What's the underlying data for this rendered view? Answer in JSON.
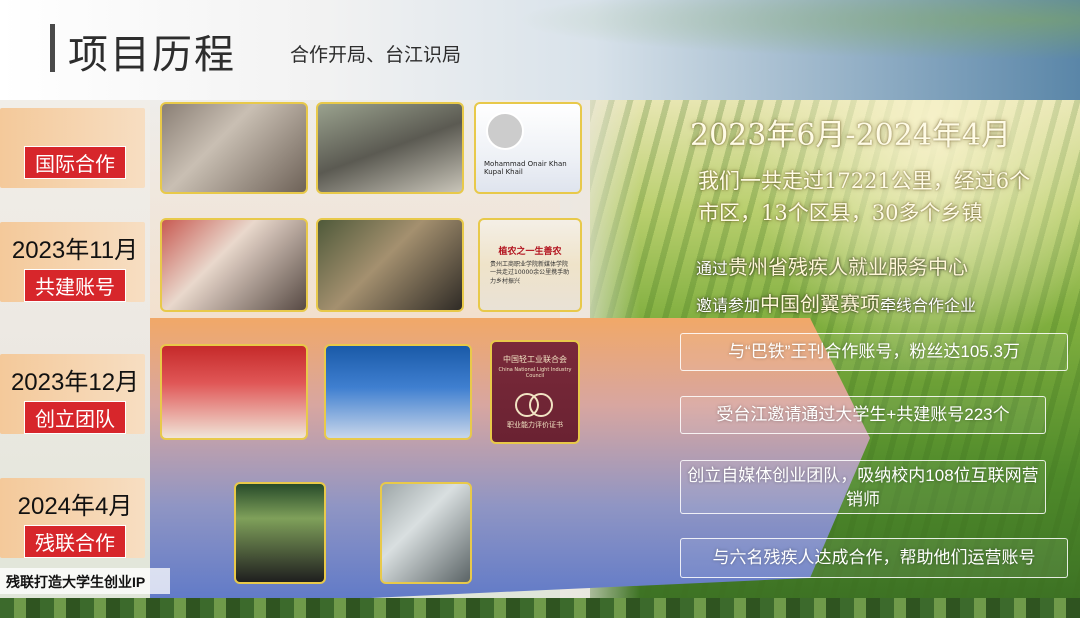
{
  "header": {
    "title": "项目历程",
    "subtitle": "合作开局、台江识局"
  },
  "milestones": [
    {
      "year": "",
      "tag": "国际合作"
    },
    {
      "year": "2023年11月",
      "tag": "共建账号"
    },
    {
      "year": "2023年12月",
      "tag": "创立团队"
    },
    {
      "year": "2024年4月",
      "tag": "残联合作"
    }
  ],
  "photos": {
    "web_profile_name": "Mohammad Onair Khan Kupal Khail",
    "doc_heading": "植农之一生善农",
    "doc_body": "贵州工商职业学院新媒体学院一共走过10000余公里携手助力乡村振兴",
    "cert_org": "中国轻工业联合会",
    "cert_org_en": "China National Light Industry Council",
    "cert_title": "职业能力评价证书"
  },
  "right": {
    "period": "2023年6月-2024年4月",
    "distance": "我们一共走过17221公里，经过6个市区，13个区县，30多个乡镇",
    "invite_small_1": "通过",
    "invite_big_1": "贵州省残疾人就业服务中心",
    "invite_small_2": "邀请参加",
    "invite_big_2": "中国创翼赛项",
    "invite_small_3": "牵线合作企业"
  },
  "facts": [
    "与“巴铁”王刊合作账号，粉丝达105.3万",
    "受台江邀请通过大学生+共建账号223个",
    "创立自媒体创业团队，吸纳校内108位互联网营销师",
    "与六名残疾人达成合作，帮助他们运营账号"
  ],
  "caption": "残联打造大学生创业IP",
  "colors": {
    "accent_red": "#d7262b",
    "photo_border": "#e8c94a",
    "label_bg": "#f4c99a"
  }
}
